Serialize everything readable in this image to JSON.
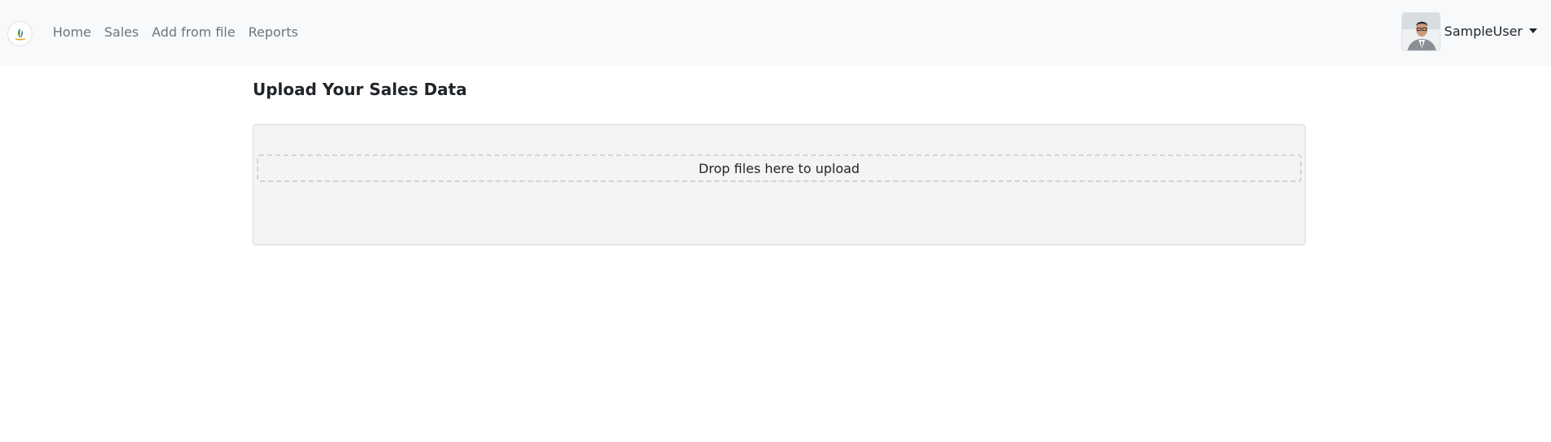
{
  "navbar": {
    "logo_icon": "leaf-logo-icon",
    "links": [
      {
        "label": "Home"
      },
      {
        "label": "Sales"
      },
      {
        "label": "Add from file"
      },
      {
        "label": "Reports"
      }
    ],
    "user": {
      "avatar_icon": "user-avatar",
      "name": "SampleUser",
      "dropdown_icon": "caret-down-icon"
    }
  },
  "main": {
    "title": "Upload Your Sales Data",
    "dropzone": {
      "message": "Drop files here to upload"
    }
  },
  "colors": {
    "navbar_bg": "#f8f9fa",
    "nav_link": "#6c757d",
    "dropzone_bg": "#f4f4f4",
    "text": "#212529"
  }
}
